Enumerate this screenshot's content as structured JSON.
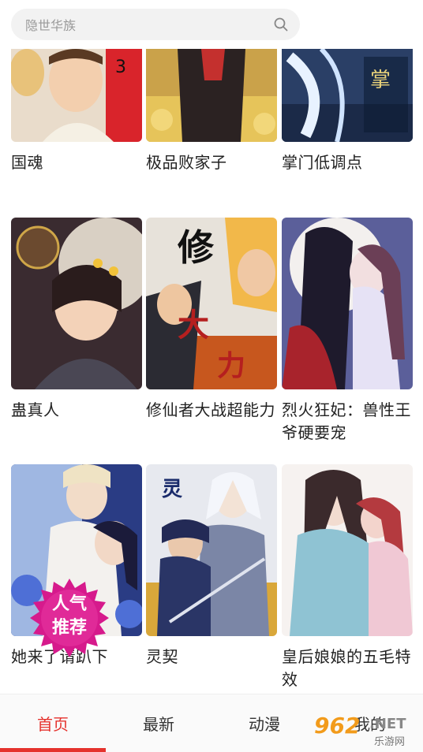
{
  "search": {
    "placeholder": "隐世华族"
  },
  "comics": [
    {
      "title": "国魂"
    },
    {
      "title": "极品败家子"
    },
    {
      "title": "掌门低调点"
    },
    {
      "title": "蛊真人"
    },
    {
      "title": "修仙者大战超能力"
    },
    {
      "title": "烈火狂妃：兽性王爷硬要宠"
    },
    {
      "title": "她来了请趴下"
    },
    {
      "title": "灵契"
    },
    {
      "title": "皇后娘娘的五毛特效"
    }
  ],
  "badge": {
    "line1": "人气",
    "line2": "推荐"
  },
  "tabs": [
    {
      "label": "首页",
      "active": true
    },
    {
      "label": "最新"
    },
    {
      "label": "动漫"
    },
    {
      "label": "我的"
    }
  ],
  "watermark": {
    "number": "962",
    "suffix": ".NET",
    "sub": "乐游网"
  },
  "colors": {
    "accent": "#e5322d",
    "badge": "#d61a8c"
  }
}
